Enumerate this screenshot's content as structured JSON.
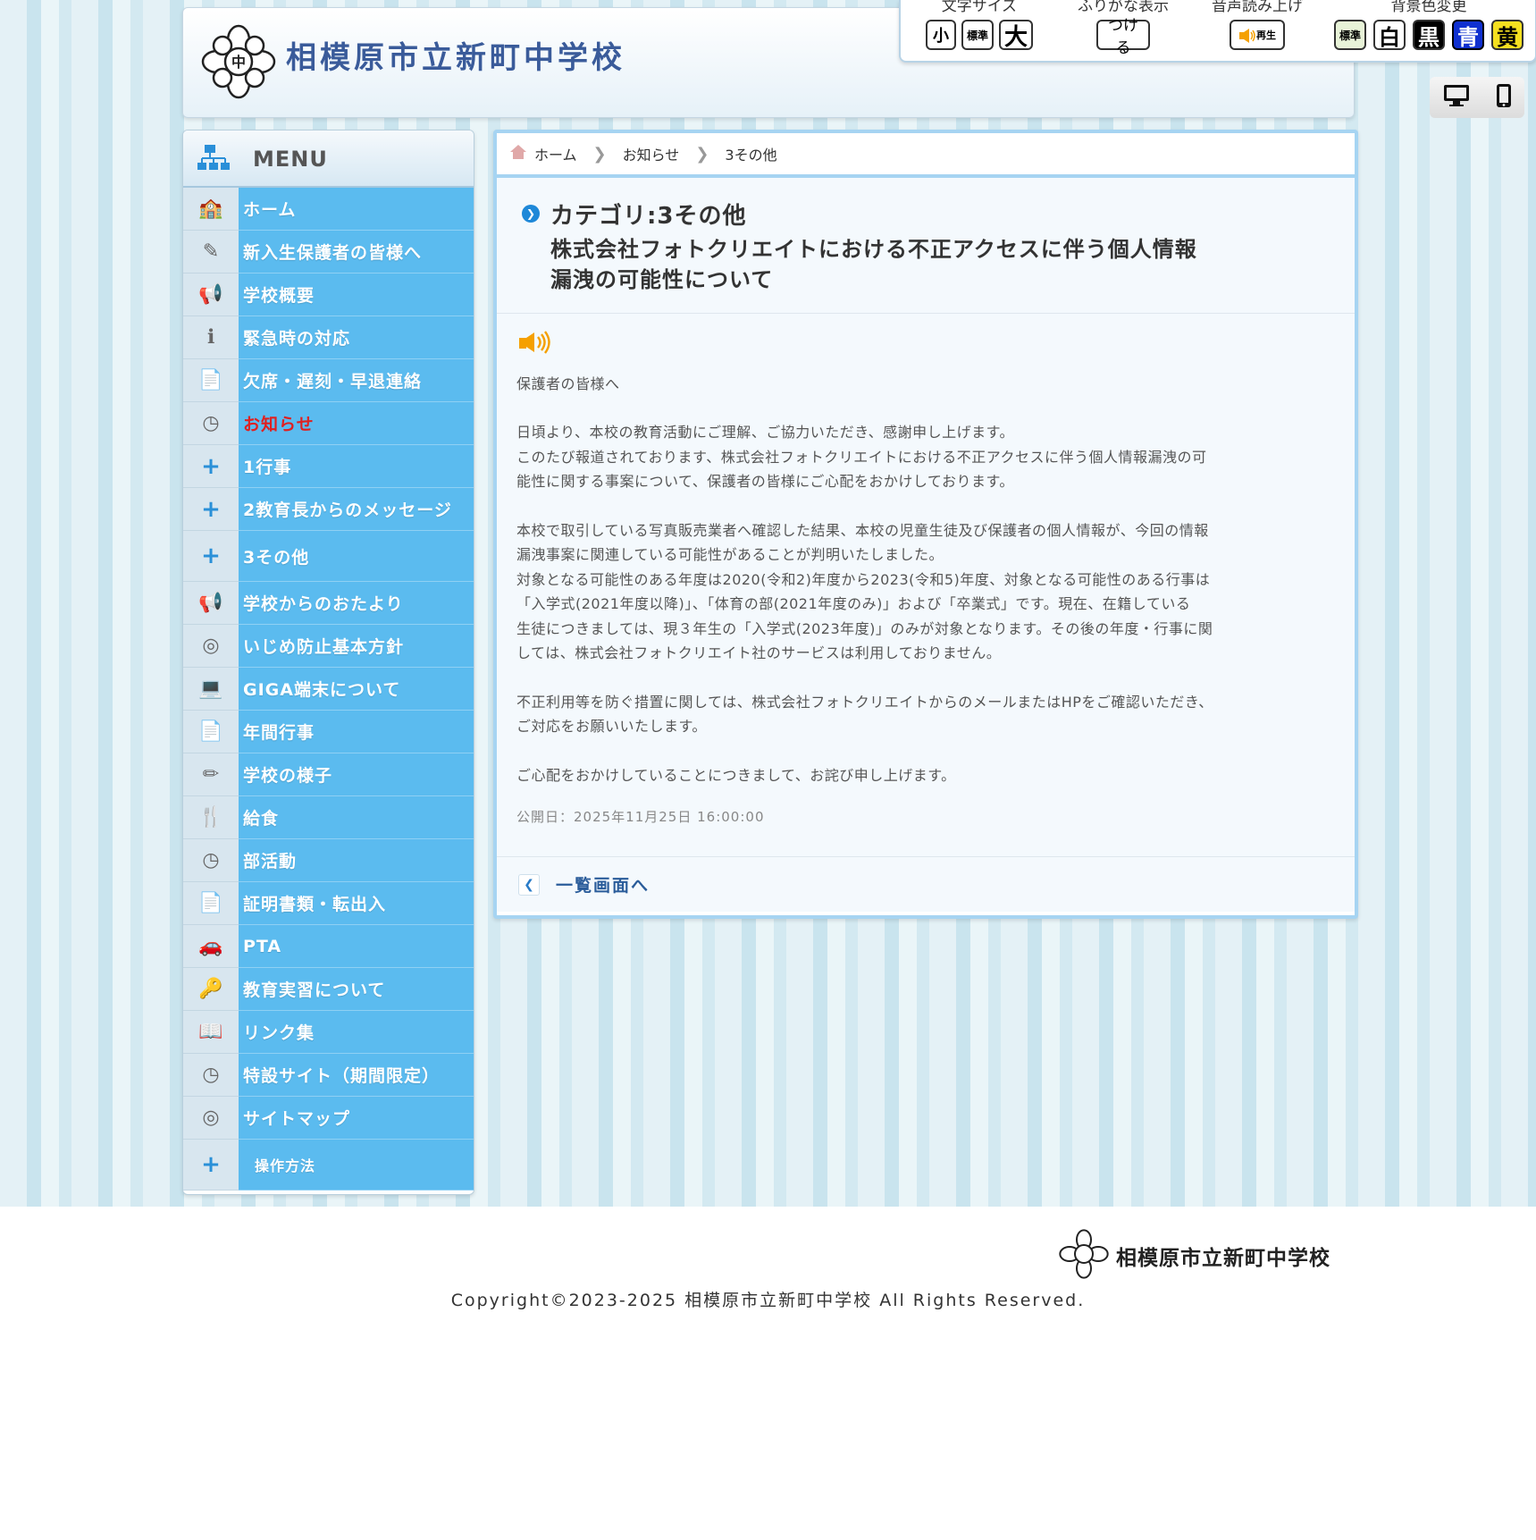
{
  "header": {
    "site_title": "相模原市立新町中学校"
  },
  "toolbar": {
    "font_size_label": "文字サイズ",
    "font_small": "小",
    "font_std": "標準",
    "font_large": "大",
    "furigana_label": "ふりがな表示",
    "furigana_on": "つける",
    "speech_label": "音声読み上げ",
    "speech_play": "再生",
    "bg_label": "背景色変更",
    "bg_std": "標準",
    "bg_white": "白",
    "bg_black": "黒",
    "bg_blue": "青",
    "bg_yellow": "黄"
  },
  "device": {
    "pc": "desktop-icon",
    "mobile": "smartphone-icon"
  },
  "sidebar": {
    "title": "MENU",
    "items": [
      {
        "label": "ホーム",
        "icon": "school-building-icon"
      },
      {
        "label": "新入生保護者の皆様へ",
        "icon": "pencil-ruler-icon"
      },
      {
        "label": "学校概要",
        "icon": "megaphone-icon"
      },
      {
        "label": "緊急時の対応",
        "icon": "info-icon"
      },
      {
        "label": "欠席・遅刻・早退連絡",
        "icon": "papers-icon"
      },
      {
        "label": "お知らせ",
        "icon": "clock-icon",
        "active": true
      },
      {
        "label": "1行事",
        "icon": "plus-icon"
      },
      {
        "label": "2教育長からのメッセージ",
        "icon": "plus-icon"
      },
      {
        "label": "3その他",
        "icon": "plus-icon"
      },
      {
        "label": "学校からのおたより",
        "icon": "megaphone-icon"
      },
      {
        "label": "いじめ防止基本方針",
        "icon": "globe-icon"
      },
      {
        "label": "GIGA端末について",
        "icon": "laptop-icon"
      },
      {
        "label": "年間行事",
        "icon": "papers-icon"
      },
      {
        "label": "学校の様子",
        "icon": "pencil-icon"
      },
      {
        "label": "給食",
        "icon": "spoon-fork-icon"
      },
      {
        "label": "部活動",
        "icon": "clock-icon"
      },
      {
        "label": "証明書類・転出入",
        "icon": "papers-icon"
      },
      {
        "label": "PTA",
        "icon": "car-icon"
      },
      {
        "label": "教育実習について",
        "icon": "key-icon"
      },
      {
        "label": "リンク集",
        "icon": "book-icon"
      },
      {
        "label": "特設サイト（期間限定）",
        "icon": "clock-icon"
      },
      {
        "label": "サイトマップ",
        "icon": "globe-icon"
      },
      {
        "label": "操作方法",
        "icon": "plus-icon"
      }
    ]
  },
  "breadcrumb": {
    "home": "ホーム",
    "news": "お知らせ",
    "category": "3その他"
  },
  "article": {
    "category": "カテゴリ:3その他",
    "title_line1": "株式会社フォトクリエイトにおける不正アクセスに伴う個人情報",
    "title_line2": "漏洩の可能性について",
    "greeting": "保護者の皆様へ",
    "p1a": "日頃より、本校の教育活動にご理解、ご協力いただき、感謝申し上げます。",
    "p1b": "このたび報道されております、株式会社フォトクリエイトにおける不正アクセスに伴う個人情報漏洩の可",
    "p1c": "能性に関する事案について、保護者の皆様にご心配をおかけしております。",
    "p2a": "本校で取引している写真販売業者へ確認した結果、本校の児童生徒及び保護者の個人情報が、今回の情報",
    "p2b": "漏洩事案に関連している可能性があることが判明いたしました。",
    "p2c": "対象となる可能性のある年度は2020(令和2)年度から2023(令和5)年度、対象となる可能性のある行事は",
    "p2d": "「入学式(2021年度以降)」、「体育の部(2021年度のみ)」および「卒業式」です。現在、在籍している",
    "p2e": "生徒につきましては、現３年生の「入学式(2023年度)」のみが対象となります。その後の年度・行事に関",
    "p2f": "しては、株式会社フォトクリエイト社のサービスは利用しておりません。",
    "p3a": "不正利用等を防ぐ措置に関しては、株式会社フォトクリエイトからのメールまたはHPをご確認いただき、",
    "p3b": "ご対応をお願いいたします。",
    "p4": "ご心配をおかけしていることにつきまして、お詫び申し上げます。",
    "published": "公開日：2025年11月25日 16:00:00",
    "back_label": "一覧画面へ"
  },
  "footer": {
    "school_name": "相模原市立新町中学校",
    "copyright": "Copyright©2023-2025 相模原市立新町中学校 All Rights Reserved."
  },
  "colors": {
    "menu_blue": "#5bbbef",
    "title_blue": "#3a5b9a",
    "active_red": "#e02020",
    "border_blue": "#a6d4f2"
  }
}
